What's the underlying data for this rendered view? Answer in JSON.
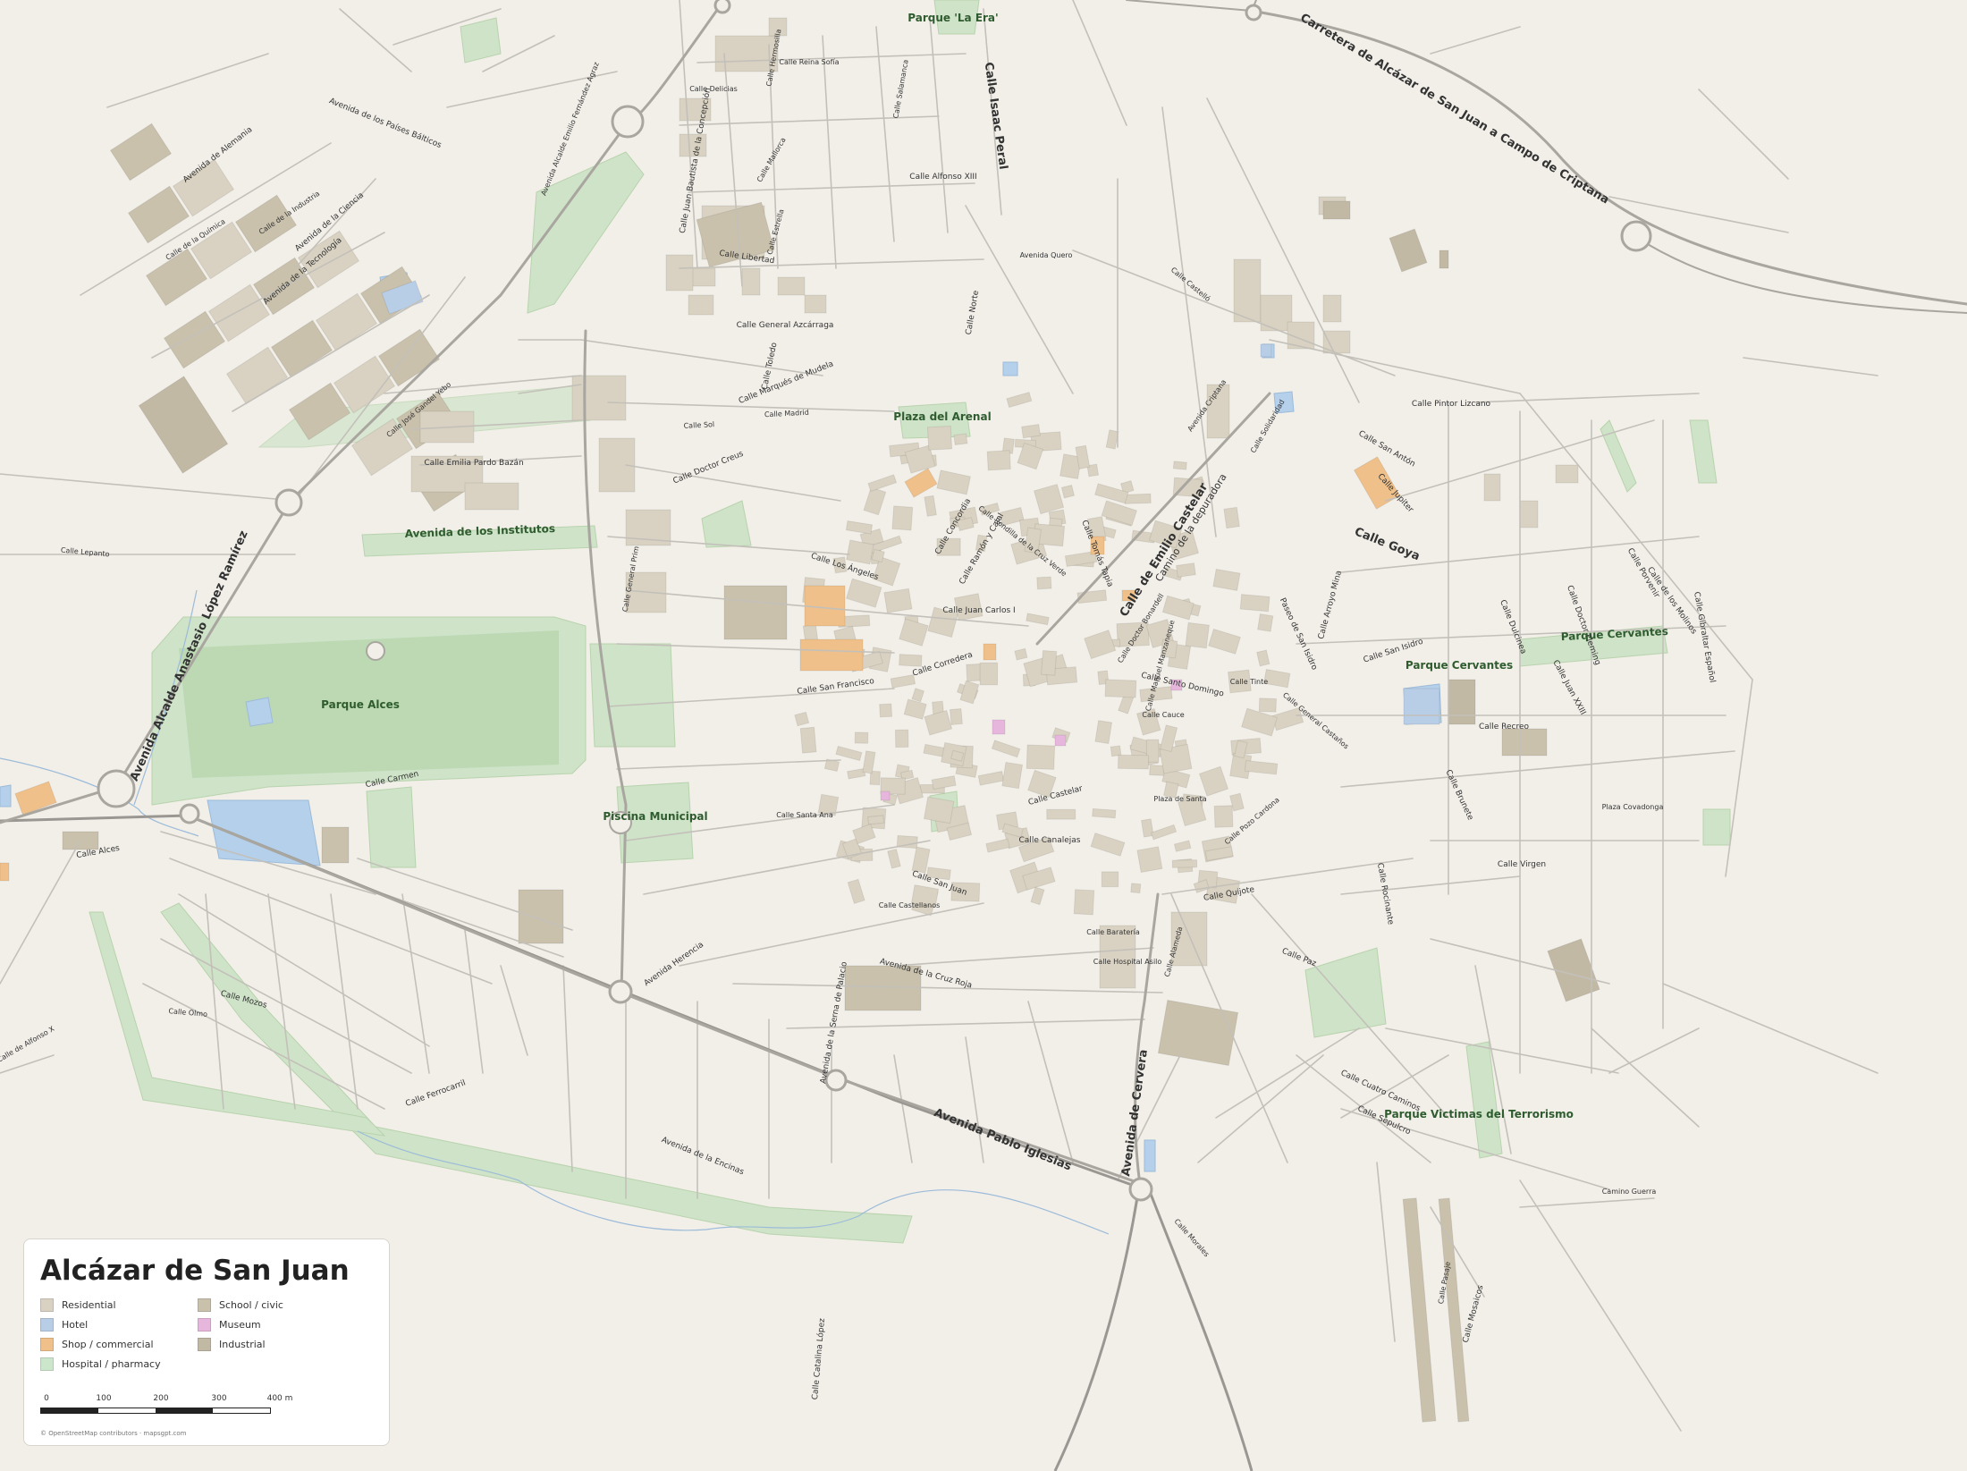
{
  "map": {
    "title": "Alcázar de San Juan",
    "legend": [
      {
        "label": "Residential",
        "color": "#d9d2c2"
      },
      {
        "label": "School / civic",
        "color": "#c9c1ac"
      },
      {
        "label": "Hotel",
        "color": "#b8cde6"
      },
      {
        "label": "Museum",
        "color": "#e6b6dc"
      },
      {
        "label": "Shop / commercial",
        "color": "#efc08a"
      },
      {
        "label": "Industrial",
        "color": "#c2b9a5"
      },
      {
        "label": "Hospital / pharmacy",
        "color": "#cce6cc"
      }
    ],
    "scale": {
      "ticks": [
        "0",
        "100",
        "200",
        "300",
        "400 m"
      ]
    },
    "attribution": "© OpenStreetMap contributors · mapsgpt.com",
    "parks": [
      "Parque 'La Era'",
      "Plaza del Arenal",
      "Avenida de los Institutos",
      "Parque Alces",
      "Piscina Municipal",
      "Parque Cervantes",
      "Parque Cervantes",
      "Parque Victimas del Terrorismo"
    ],
    "major_roads": [
      "Carretera de Alcázar de San Juan a Campo de Criptana",
      "Avenida Alcalde Anastasio López Ramírez",
      "Avenida Pablo Iglesias",
      "Calle de Emilio Castelar",
      "Calle Isaac Peral",
      "Avenida de Cervera",
      "Calle Goya"
    ],
    "streets": [
      "Avenida Alcalde Emilio Fernández Agraz",
      "Avenida de Alemania",
      "Avenida de los Países Bálticos",
      "Calle de la Industria",
      "Avenida de la Ciencia",
      "Avenida de la Tecnología",
      "Calle de la Química",
      "Calle José Gandel Yebo",
      "Calle Emilia Pardo Bazán",
      "Calle Juan Bautista de la Concepción",
      "Calle Libertad",
      "Calle Mallorca",
      "Calle Estrella",
      "Calle Salamanca",
      "Calle Alfonso XIII",
      "Calle Delicias",
      "Calle Hermosilla",
      "Calle Reina Sofía",
      "Avenida Quero",
      "Calle Castelló",
      "Calle General Azcárraga",
      "Calle Marqués de Mudela",
      "Calle Norte",
      "Calle Toledo",
      "Calle Madrid",
      "Calle Sol",
      "Calle Doctor Creus",
      "Calle General Prim",
      "Calle Los Ángeles",
      "Calle Juan Carlos I",
      "Calle Tomás Tapia",
      "Calle Concordia",
      "Calle Ramón y Cajal",
      "Calle Rondilla de la Cruz Verde",
      "Calle Corredera",
      "Calle Santo Domingo",
      "Calle San Francisco",
      "Calle Doctor Bonardell",
      "Calle Manuel Manzaneque",
      "Calle Castelar",
      "Calle Canalejas",
      "Calle San Juan",
      "Calle Santa Ana",
      "Calle Carmen",
      "Calle Alces",
      "Avenida Herencia",
      "Avenida de la Cruz Roja",
      "Calle Quijote",
      "Calle Paz",
      "Calle Recreo",
      "Calle Brunete",
      "Calle Virgen",
      "Calle San Isidro",
      "Paseo de San Isidro",
      "Calle Arroyo Mina",
      "Calle San Antón",
      "Calle Pintor Lizcano",
      "Calle Solidaridad",
      "Avenida Criptana",
      "Calle Mozos",
      "Calle Ferrocarril",
      "Avenida de la Encinas",
      "Avenida de la Serna de Palacio",
      "Calle Catalina López",
      "Calle Mosaicos",
      "Camino Guerra",
      "Calle Cuatro Caminos",
      "Calle Sepulcro",
      "Calle Porvenir",
      "Calle de los Molinos",
      "Calle Gibraltar Español",
      "Calle Doctor Fleming",
      "Calle Juan XXIII",
      "Calle Dulcinea",
      "Calle Rocinante",
      "Calle Baratería",
      "Calle Hospital Asilo",
      "Calle Castellanos",
      "Calle Morales",
      "Calle Pozo Cardona",
      "Calle Alameda",
      "Calle Jupiter",
      "Calle General Castaños",
      "Calle Lepanto",
      "Calle de Alfonso X",
      "Camino de la depuradora",
      "Calle Arroyo Valdegamo",
      "Calle Emilio Castelar"
    ],
    "places": [
      "Calle Olmo",
      "Calle Tinte",
      "Calle Cauce",
      "Plaza de Santa",
      "Plaza Covadonga",
      "Calle Pasaje"
    ]
  }
}
